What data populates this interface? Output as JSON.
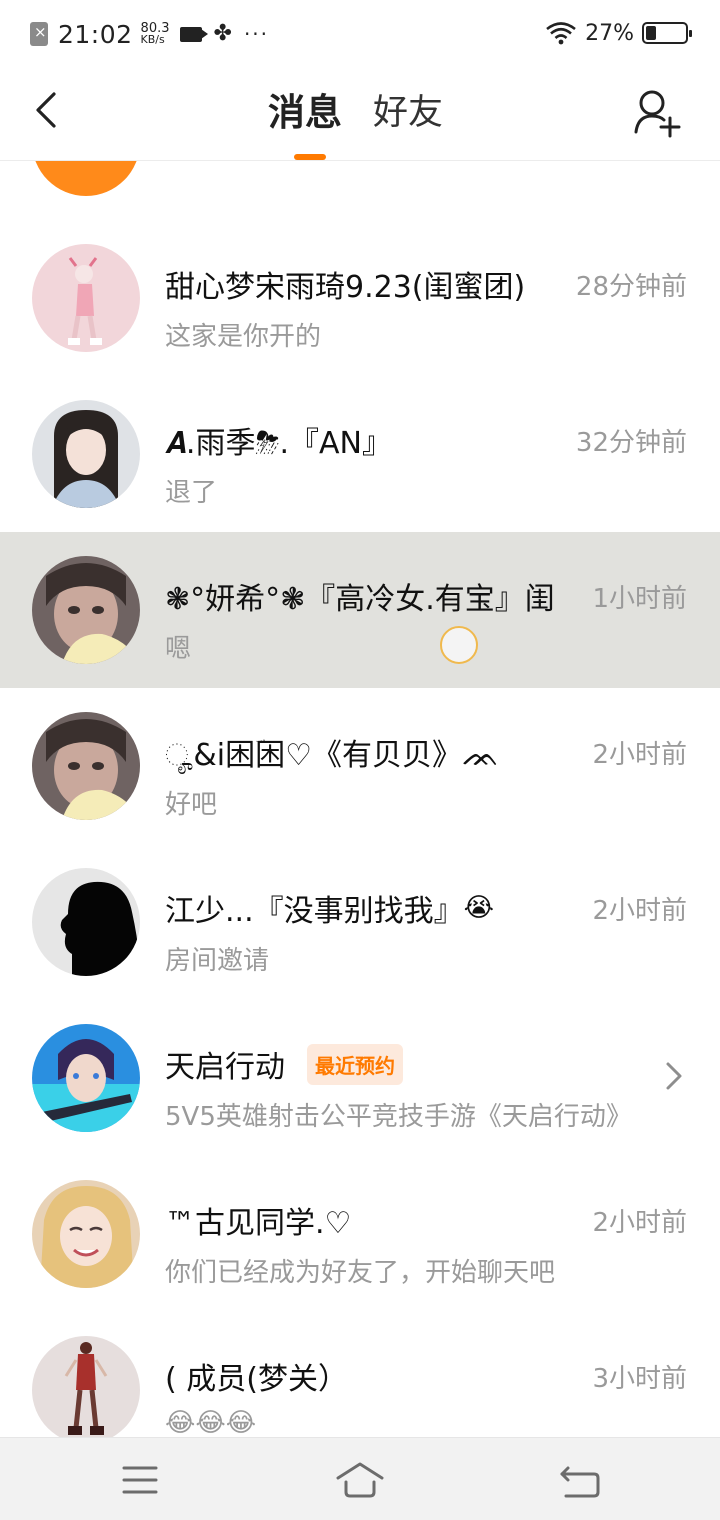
{
  "status_bar": {
    "time": "21:02",
    "net_speed_value": "80.3",
    "net_speed_unit": "KB/s",
    "more": "···",
    "battery_percent": "27%"
  },
  "header": {
    "tab_messages": "消息",
    "tab_friends": "好友",
    "accent_color": "#ff7a00"
  },
  "conversations": [
    {
      "title": "甜心梦宋雨琦9.23(闺蜜团)",
      "time": "28分钟前",
      "preview": "这家是你开的"
    },
    {
      "title": "𝑨.雨季⛈.『AN』",
      "time": "32分钟前",
      "preview": "退了"
    },
    {
      "title": "❃°妍希°❃『高冷女.有宝』闺",
      "time": "1小时前",
      "preview": "嗯"
    },
    {
      "title": "ೄ&i困ؔ困♡《有贝贝》ᨏ",
      "time": "2小时前",
      "preview": "好吧"
    },
    {
      "title": "江少...『没事别找我』",
      "title_emoji": "😭",
      "time": "2小时前",
      "preview": "房间邀请"
    },
    {
      "title": "天启行动",
      "badge": "最近预约",
      "preview": "5V5英雄射击公平竞技手游《天启行动》"
    },
    {
      "title": "™古见同学.♡",
      "time": "2小时前",
      "preview": "你们已经成为好友了，开始聊天吧"
    },
    {
      "title": "(    成员(梦关）",
      "time": "3小时前",
      "preview": "😂😂😂"
    }
  ]
}
